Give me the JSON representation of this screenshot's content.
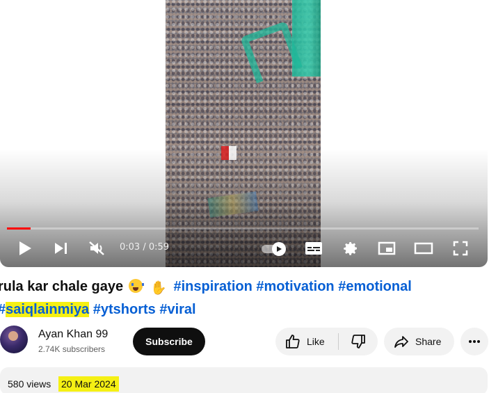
{
  "player": {
    "time_current": "0:03",
    "time_separator": " / ",
    "time_total": "0:59",
    "progress_fraction": 0.05,
    "controls": {
      "play": "play-icon",
      "next": "next-icon",
      "mute": "muted-icon",
      "autoplay": "autoplay-toggle",
      "captions": "captions-icon",
      "settings": "gear-icon",
      "miniplayer": "miniplayer-icon",
      "theater": "theater-icon",
      "fullscreen": "fullscreen-icon"
    }
  },
  "video": {
    "title_text": "rula kar chale gaye",
    "hashtags_line1": [
      "#inspiration",
      "#motivation",
      "#emotional"
    ],
    "highlight_hash": "#",
    "highlight_tag": "saiqlainmiya",
    "hashtags_line2": [
      "#ytshorts",
      "#viral"
    ]
  },
  "channel": {
    "name": "Ayan Khan 99",
    "subscribers": "2.74K subscribers",
    "subscribe_label": "Subscribe"
  },
  "actions": {
    "like_label": "Like",
    "share_label": "Share"
  },
  "description": {
    "views": "580 views",
    "date": "20 Mar 2024"
  },
  "colors": {
    "progress": "#ff0000",
    "hashtag": "#065fd4",
    "highlight": "#f5f014"
  }
}
